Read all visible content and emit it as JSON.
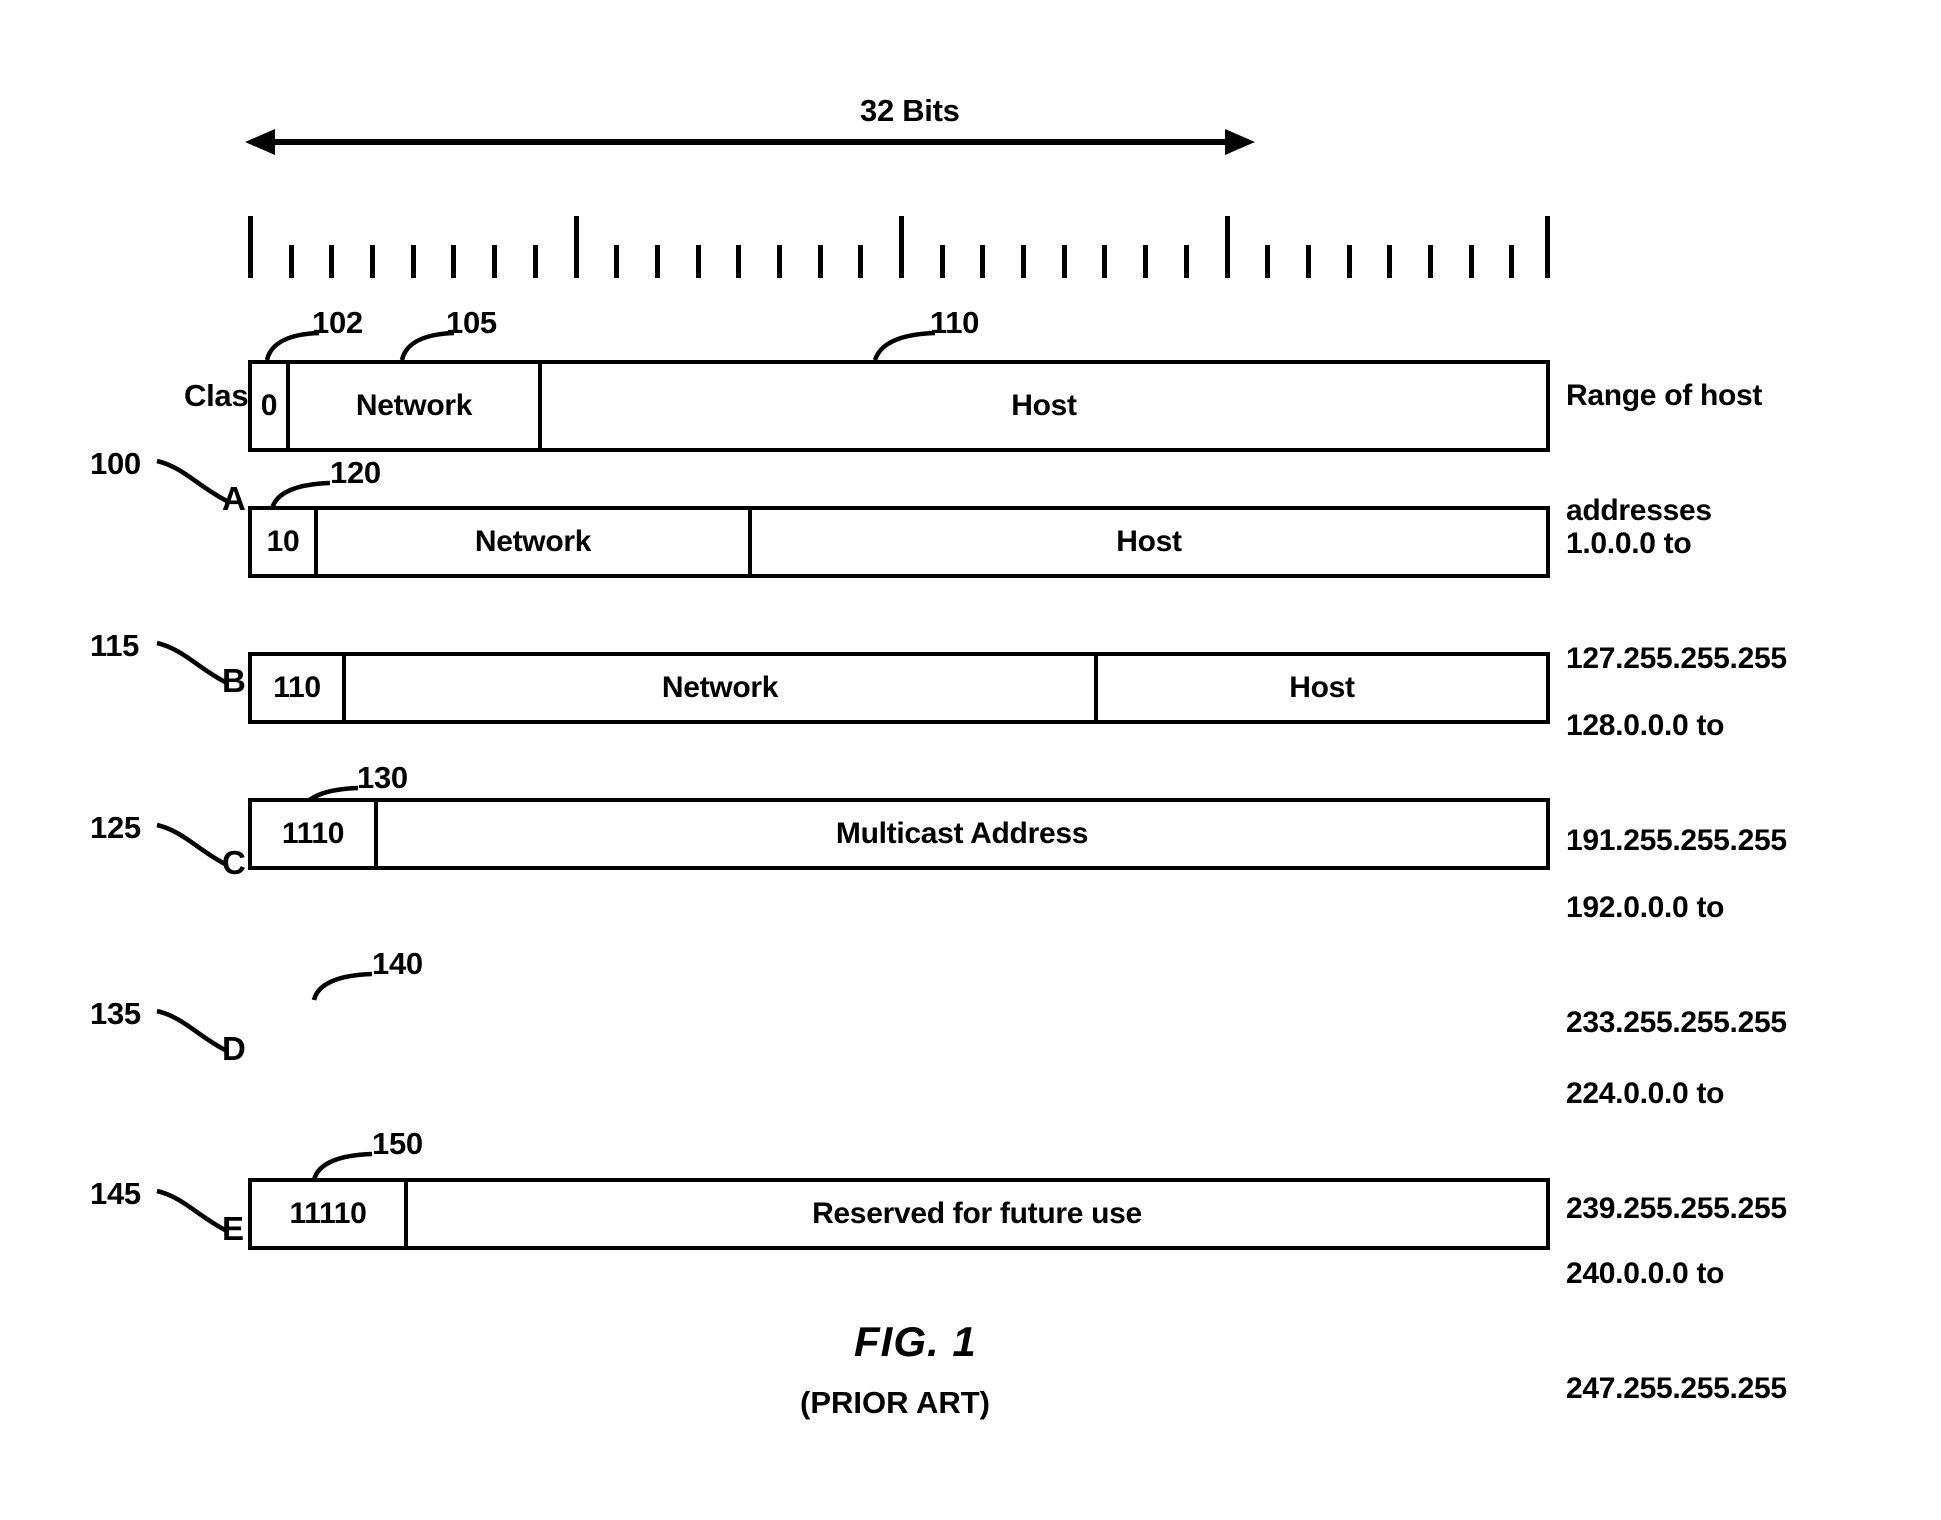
{
  "figure": {
    "caption": "FIG. 1",
    "subcaption": "(PRIOR ART)"
  },
  "header": {
    "bits_label": "32 Bits",
    "class_label": "Class",
    "range_label_line1": "Range of host",
    "range_label_line2": "addresses"
  },
  "ruler": {
    "total_bits": 32,
    "major_every": 8,
    "major_count": 5
  },
  "rows": [
    {
      "ref": "100",
      "class_letter": "A",
      "prefix": "0",
      "callouts": [
        {
          "ref": "102",
          "target": "prefix"
        },
        {
          "ref": "105",
          "target": "network"
        },
        {
          "ref": "110",
          "target": "host"
        }
      ],
      "fields": [
        {
          "label": "0",
          "kind": "prefix"
        },
        {
          "label": "Network",
          "kind": "network"
        },
        {
          "label": "Host",
          "kind": "host"
        }
      ],
      "range_line1": "1.0.0.0 to",
      "range_line2": "127.255.255.255"
    },
    {
      "ref": "115",
      "class_letter": "B",
      "prefix": "10",
      "callouts": [
        {
          "ref": "120",
          "target": "prefix"
        }
      ],
      "fields": [
        {
          "label": "10",
          "kind": "prefix"
        },
        {
          "label": "Network",
          "kind": "network"
        },
        {
          "label": "Host",
          "kind": "host"
        }
      ],
      "range_line1": "128.0.0.0 to",
      "range_line2": "191.255.255.255"
    },
    {
      "ref": "125",
      "class_letter": "C",
      "prefix": "110",
      "callouts": [
        {
          "ref": "130",
          "target": "prefix"
        }
      ],
      "fields": [
        {
          "label": "110",
          "kind": "prefix"
        },
        {
          "label": "Network",
          "kind": "network"
        },
        {
          "label": "Host",
          "kind": "host"
        }
      ],
      "range_line1": "192.0.0.0 to",
      "range_line2": "233.255.255.255"
    },
    {
      "ref": "135",
      "class_letter": "D",
      "prefix": "1110",
      "callouts": [
        {
          "ref": "140",
          "target": "prefix"
        }
      ],
      "fields": [
        {
          "label": "1110",
          "kind": "prefix"
        },
        {
          "label": "Multicast Address",
          "kind": "payload"
        }
      ],
      "range_line1": "224.0.0.0 to",
      "range_line2": "239.255.255.255"
    },
    {
      "ref": "145",
      "class_letter": "E",
      "prefix": "11110",
      "callouts": [
        {
          "ref": "150",
          "target": "prefix"
        }
      ],
      "fields": [
        {
          "label": "11110",
          "kind": "prefix"
        },
        {
          "label": "Reserved for future use",
          "kind": "payload"
        }
      ],
      "range_line1": "240.0.0.0 to",
      "range_line2": "247.255.255.255"
    }
  ],
  "colors": {
    "ink": "#000000",
    "paper": "#ffffff"
  }
}
